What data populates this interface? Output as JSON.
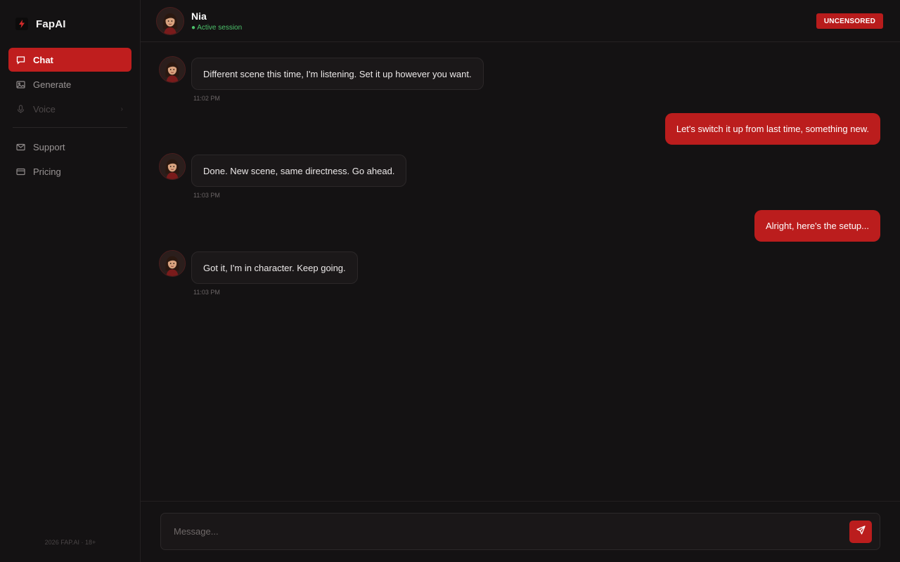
{
  "brand": {
    "name": "FapAI",
    "accent": "#bf1e1e"
  },
  "sidebar": {
    "items": [
      {
        "label": "Chat",
        "icon": "chat-bubble-icon",
        "state": "active"
      },
      {
        "label": "Generate",
        "icon": "image-icon",
        "state": "normal"
      },
      {
        "label": "Voice",
        "icon": "microphone-icon",
        "state": "disabled"
      },
      {
        "label": "Support",
        "icon": "mail-icon",
        "state": "normal"
      },
      {
        "label": "Pricing",
        "icon": "credit-card-icon",
        "state": "normal"
      }
    ],
    "footer": "2026 FAP.AI · 18+"
  },
  "header": {
    "name": "Nia",
    "status": "● Active session",
    "badge": "UNCENSORED"
  },
  "messages": [
    {
      "role": "ai",
      "text": "Different scene this time, I'm listening. Set it up however you want.",
      "time": "11:02 PM"
    },
    {
      "role": "user",
      "text": "Let's switch it up from last time, something new."
    },
    {
      "role": "ai",
      "text": "Done. New scene, same directness. Go ahead.",
      "time": "11:03 PM"
    },
    {
      "role": "user",
      "text": "Alright, here's the setup..."
    },
    {
      "role": "ai",
      "text": "Got it, I'm in character. Keep going.",
      "time": "11:03 PM"
    }
  ],
  "composer": {
    "placeholder": "Message...",
    "send_icon": "send-icon"
  }
}
